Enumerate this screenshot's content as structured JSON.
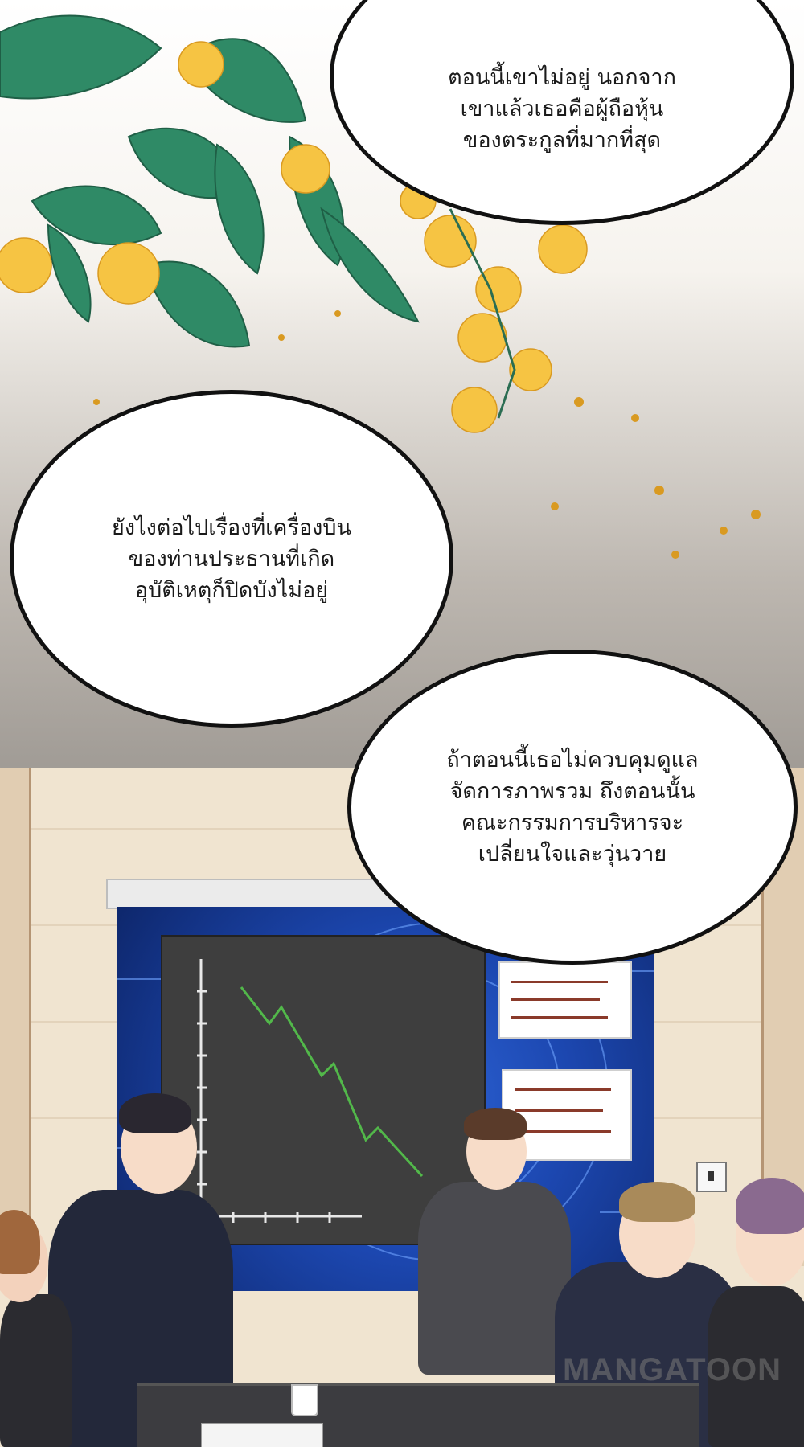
{
  "bubbles": [
    {
      "text": "ตอนนี้เขาไม่อยู่ นอกจาก\nเขาแล้วเธอคือผู้ถือหุ้น\nของตระกูลที่มากที่สุด"
    },
    {
      "text": "ยังไงต่อไปเรื่องที่เครื่องบิน\nของท่านประธานที่เกิด\nอุบัติเหตุก็ปิดบังไม่อยู่"
    },
    {
      "text": "ถ้าตอนนี้เธอไม่ควบคุมดูแล\nจัดการภาพรวม ถึงตอนนั้น\nคณะกรรมการบริหารจะ\nเปลี่ยนใจและวุ่นวาย"
    }
  ],
  "watermark": "MANGATOON",
  "colors": {
    "leaf": "#2f8a66",
    "flower": "#f6c443",
    "screen": "#1c47b0",
    "chart_line": "#52b84a",
    "suit": "#23283a"
  }
}
